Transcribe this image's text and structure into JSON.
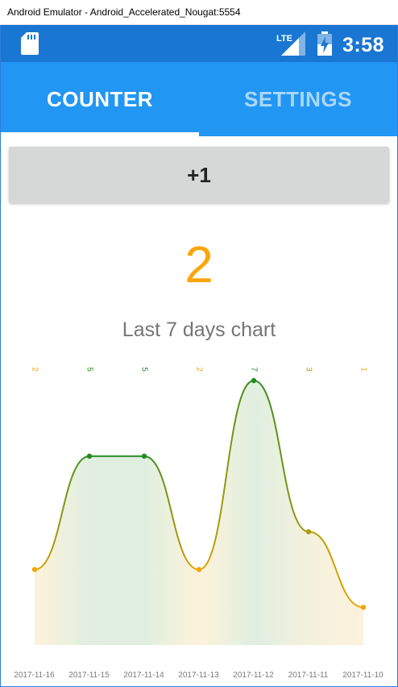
{
  "window": {
    "title": "Android Emulator - Android_Accelerated_Nougat:5554"
  },
  "status_bar": {
    "time": "3:58",
    "network": "LTE",
    "icons": [
      "sd-card-icon",
      "lte-signal-icon",
      "battery-charging-icon"
    ]
  },
  "tabs": [
    {
      "label": "COUNTER",
      "selected": true
    },
    {
      "label": "SETTINGS",
      "selected": false
    }
  ],
  "counter": {
    "button_label": "+1",
    "value": "2"
  },
  "colors": {
    "status_bar": "#1976d2",
    "tab_bar": "#2196f3",
    "counter_value": "#fca50a",
    "low": "#f5a500",
    "high": "#228b22"
  },
  "chart_data": {
    "type": "line",
    "title": "Last 7 days chart",
    "categories": [
      "2017-11-16",
      "2017-11-15",
      "2017-11-14",
      "2017-11-13",
      "2017-11-12",
      "2017-11-11",
      "2017-11-10"
    ],
    "values": [
      2,
      5,
      5,
      2,
      7,
      3,
      1
    ],
    "value_labels": [
      "2",
      "5",
      "5",
      "2",
      "7",
      "3",
      "1"
    ],
    "ylim": [
      0,
      7
    ],
    "grid": false,
    "legend": "none"
  }
}
